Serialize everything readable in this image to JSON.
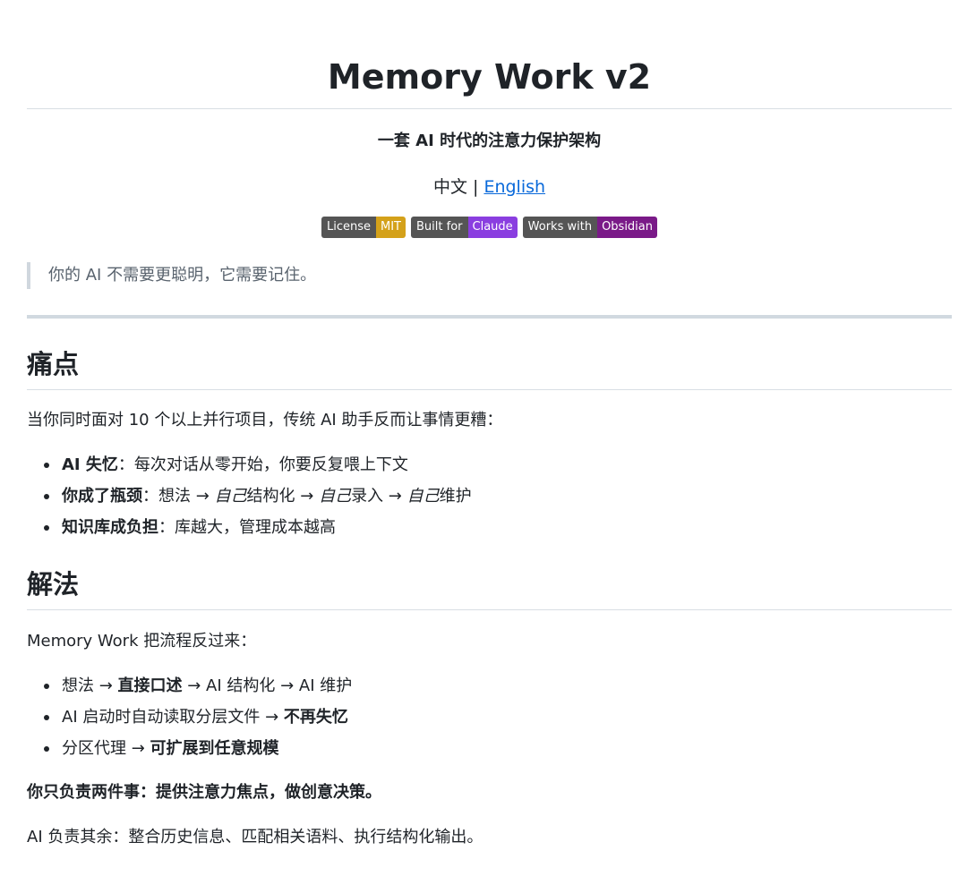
{
  "title": "Memory Work v2",
  "subtitle": "一套 AI 时代的注意力保护架构",
  "language": {
    "current": "中文",
    "separator": " | ",
    "english_link": "English"
  },
  "badges": [
    {
      "label": "License",
      "value": "MIT",
      "color": "#d4a11a"
    },
    {
      "label": "Built for",
      "value": "Claude",
      "color": "#8a3ee0"
    },
    {
      "label": "Works with",
      "value": "Obsidian",
      "color": "#7a1a88"
    }
  ],
  "quote": "你的 AI 不需要更聪明，它需要记住。",
  "pain": {
    "heading": "痛点",
    "intro": "当你同时面对 10 个以上并行项目，传统 AI 助手反而让事情更糟：",
    "items": [
      {
        "bold": "AI 失忆",
        "rest": "：每次对话从零开始，你要反复喂上下文"
      },
      {
        "bold": "你成了瓶颈",
        "p1": "：想法 → ",
        "i1": "自己",
        "p2": "结构化 → ",
        "i2": "自己",
        "p3": "录入 → ",
        "i3": "自己",
        "p4": "维护"
      },
      {
        "bold": "知识库成负担",
        "rest": "：库越大，管理成本越高"
      }
    ]
  },
  "solution": {
    "heading": "解法",
    "intro": "Memory Work 把流程反过来：",
    "items": [
      {
        "pre": "想法 → ",
        "bold": "直接口述",
        "post": " → AI 结构化 → AI 维护"
      },
      {
        "pre": "AI 启动时自动读取分层文件 → ",
        "bold": "不再失忆",
        "post": ""
      },
      {
        "pre": "分区代理 → ",
        "bold": "可扩展到任意规模",
        "post": ""
      }
    ],
    "bold_line": "你只负责两件事：提供注意力焦点，做创意决策。",
    "last_line": "AI 负责其余：整合历史信息、匹配相关语料、执行结构化输出。"
  }
}
